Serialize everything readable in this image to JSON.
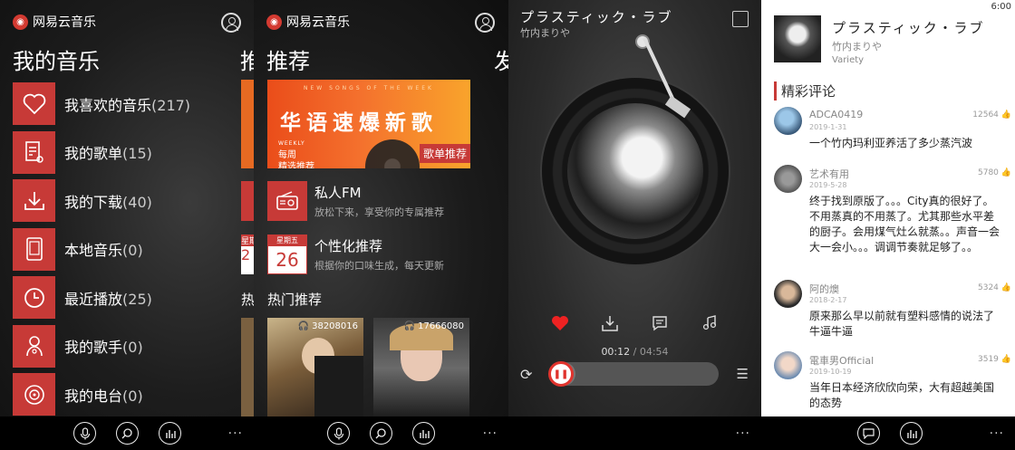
{
  "status": {
    "time": "6:00"
  },
  "brand": {
    "name": "网易云音乐"
  },
  "panel1": {
    "title": "我的音乐",
    "peek": "推",
    "items": [
      {
        "label": "我喜欢的音乐",
        "count": "(217)",
        "icon": "heart-icon"
      },
      {
        "label": "我的歌单",
        "count": "(15)",
        "icon": "playlist-icon"
      },
      {
        "label": "我的下载",
        "count": "(40)",
        "icon": "download-icon"
      },
      {
        "label": "本地音乐",
        "count": "(0)",
        "icon": "phone-icon"
      },
      {
        "label": "最近播放",
        "count": "(25)",
        "icon": "clock-icon"
      },
      {
        "label": "我的歌手",
        "count": "(0)",
        "icon": "singer-icon"
      },
      {
        "label": "我的电台",
        "count": "(0)",
        "icon": "radio-icon"
      }
    ],
    "peek_tiles": [
      {
        "date_head": "星期",
        "date_num": "2"
      }
    ],
    "peek_hot": "热"
  },
  "panel2": {
    "title": "推荐",
    "peek": "发",
    "banner": {
      "top": "NEW SONGS OF THE WEEK",
      "main": "华语速爆新歌",
      "weekly": "WEEKLY",
      "sub1": "每周",
      "sub2": "精选推荐",
      "tag": "歌单推荐"
    },
    "fm": {
      "title": "私人FM",
      "subtitle": "放松下来，享受你的专属推荐"
    },
    "personal": {
      "title": "个性化推荐",
      "subtitle": "根据你的口味生成，每天更新",
      "date_head": "星期五",
      "date_num": "26"
    },
    "hot_title": "热门推荐",
    "covers": [
      {
        "count": "38208016"
      },
      {
        "count": "17666080"
      }
    ]
  },
  "player": {
    "title": "プラスティック・ラブ",
    "artist": "竹内まりや",
    "time_current": "00:12",
    "time_total": "/ 04:54",
    "progress": 0.04
  },
  "detail": {
    "title": "プラスティック・ラブ",
    "artist": "竹内まりや",
    "album": "Variety",
    "comments_header": "精彩评论",
    "comments": [
      {
        "user": "ADCA0419",
        "date": "2019-1-31",
        "likes": "12564",
        "text": "一个竹内玛利亚养活了多少蒸汽波"
      },
      {
        "user": "艺术有用",
        "date": "2019-5-28",
        "likes": "5780",
        "text": "终于找到原版了。。。City真的很好了。不用蒸真的不用蒸了。尤其那些水平差的厨子。会用煤气灶么就蒸。。声音一会大一会小。。。调调节奏就足够了。。"
      },
      {
        "user": "阿的燠",
        "date": "2018-2-17",
        "likes": "5324",
        "text": "原来那么早以前就有塑料感情的说法了牛逼牛逼"
      },
      {
        "user": "電車男Official",
        "date": "2019-10-19",
        "likes": "3519",
        "text": "当年日本经济欣欣向荣，大有超越美国的态势"
      }
    ]
  },
  "bottom": {
    "more": "···"
  }
}
